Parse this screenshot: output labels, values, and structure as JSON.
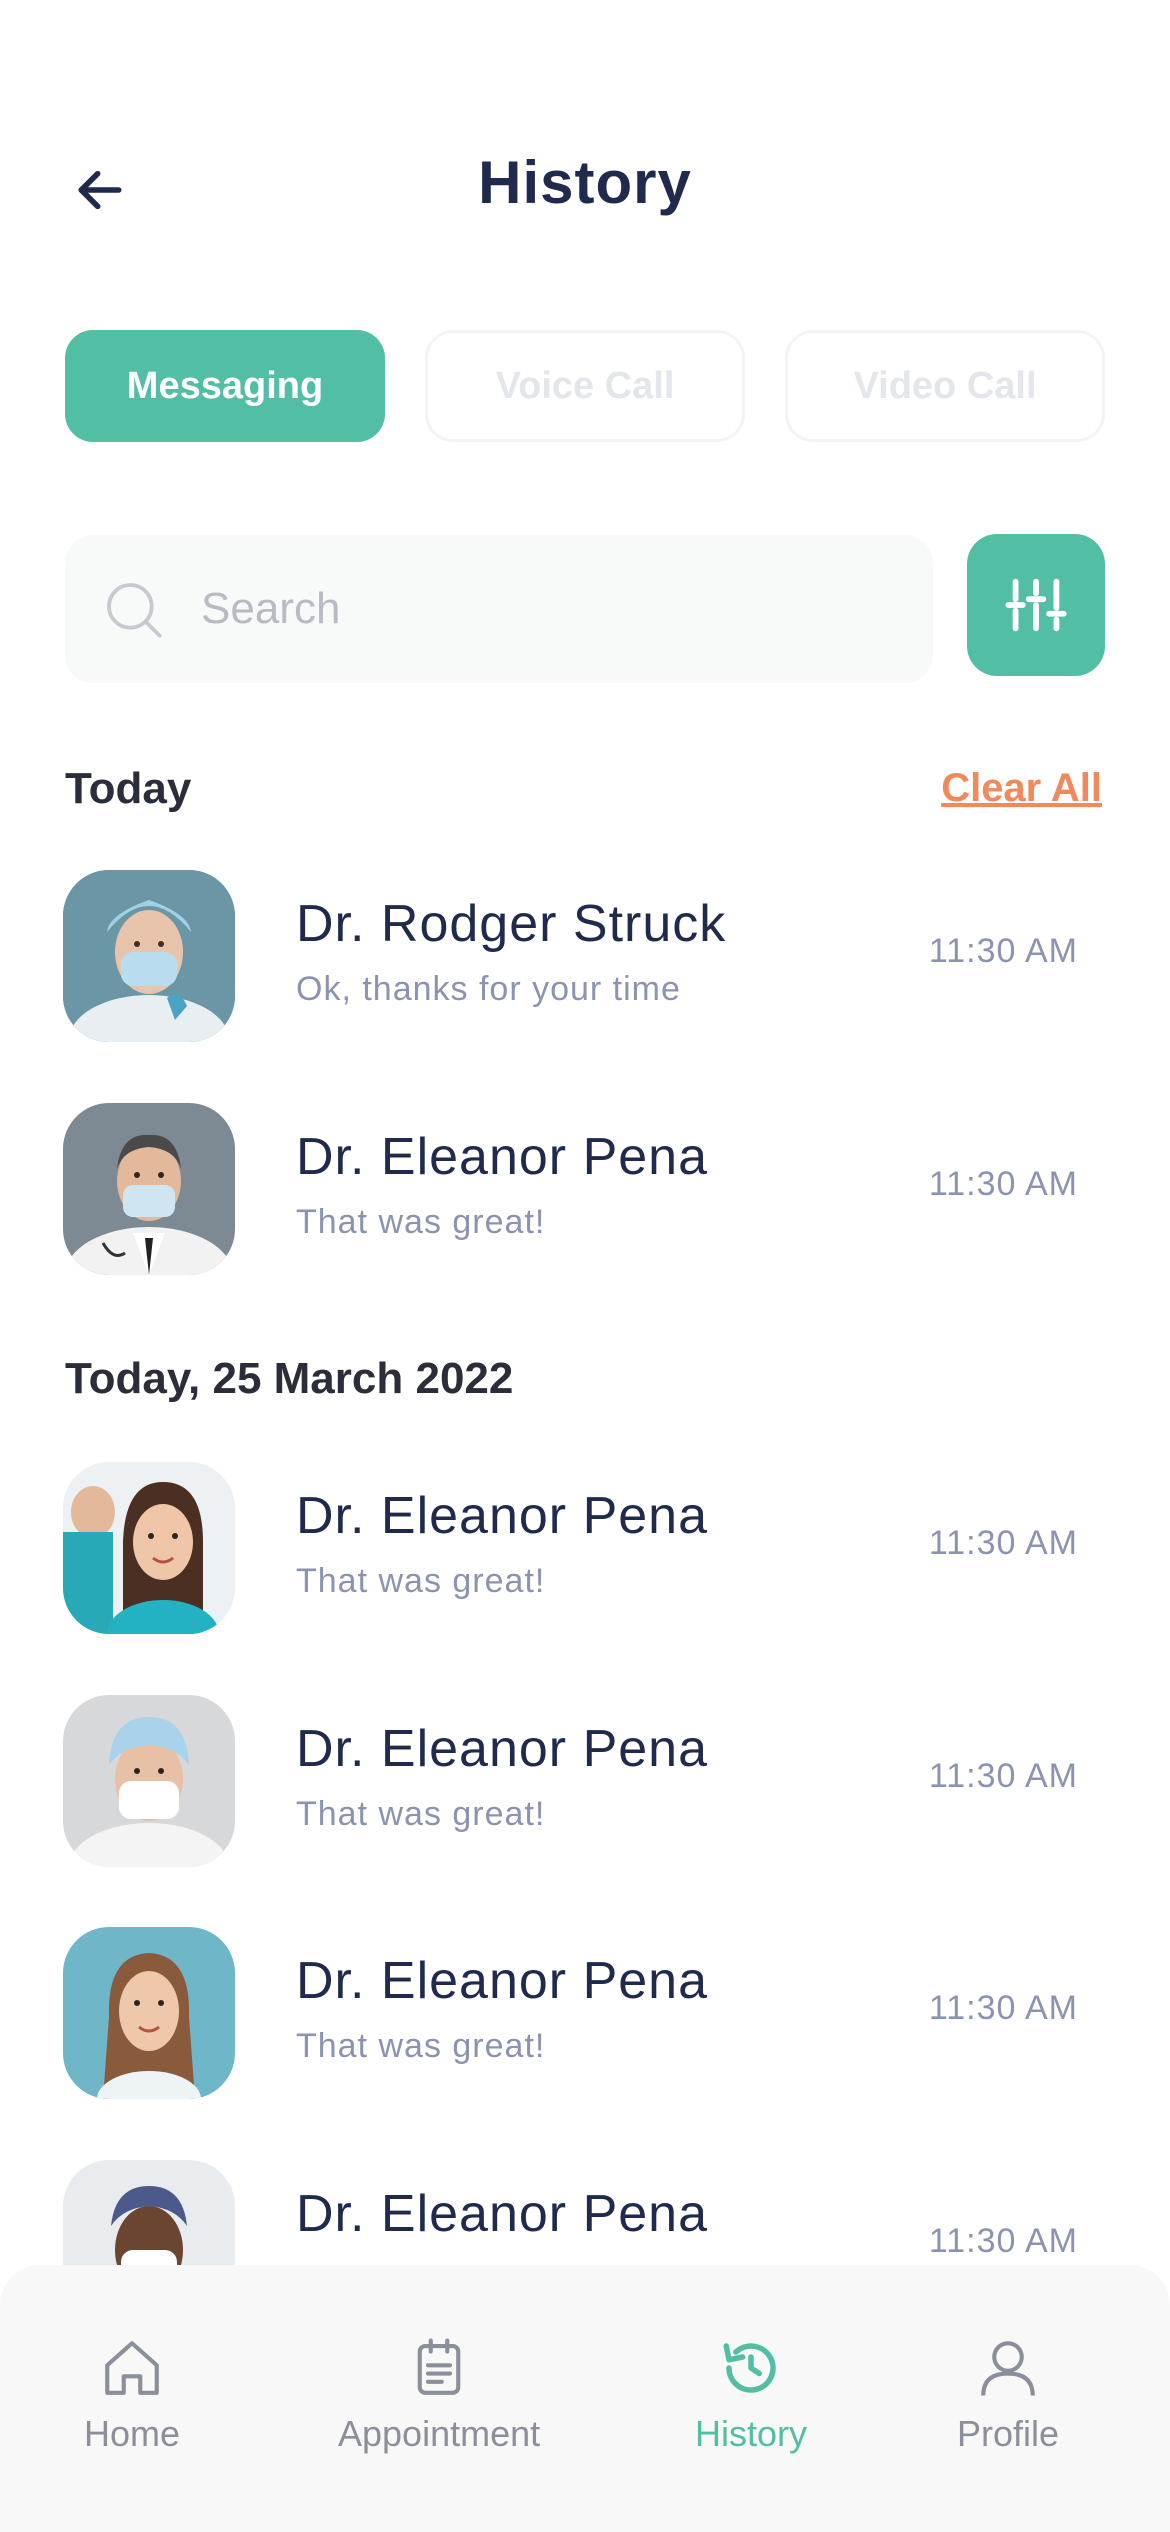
{
  "header": {
    "title": "History",
    "back_icon": "arrow-left-icon"
  },
  "tabs": [
    {
      "label": "Messaging",
      "active": true
    },
    {
      "label": "Voice Call",
      "active": false
    },
    {
      "label": "Video Call",
      "active": false
    }
  ],
  "search": {
    "placeholder": "Search",
    "value": "",
    "icon": "search-icon"
  },
  "filter": {
    "icon": "sliders-icon"
  },
  "sections": [
    {
      "title": "Today",
      "action_label": "Clear All",
      "items": [
        {
          "name": "Dr. Rodger Struck",
          "message": "Ok, thanks for your time",
          "time": "11:30 AM"
        },
        {
          "name": "Dr. Eleanor Pena",
          "message": "That was great!",
          "time": "11:30 AM"
        }
      ]
    },
    {
      "title": "Today, 25 March 2022",
      "items": [
        {
          "name": "Dr. Eleanor Pena",
          "message": "That was great!",
          "time": "11:30 AM"
        },
        {
          "name": "Dr. Eleanor Pena",
          "message": "That was great!",
          "time": "11:30 AM"
        },
        {
          "name": "Dr. Eleanor Pena",
          "message": "That was great!",
          "time": "11:30 AM"
        },
        {
          "name": "Dr. Eleanor Pena",
          "message": "",
          "time": "11:30 AM"
        }
      ]
    }
  ],
  "nav": [
    {
      "label": "Home",
      "icon": "home-icon",
      "active": false
    },
    {
      "label": "Appointment",
      "icon": "clipboard-icon",
      "active": false
    },
    {
      "label": "History",
      "icon": "history-icon",
      "active": true
    },
    {
      "label": "Profile",
      "icon": "user-icon",
      "active": false
    }
  ],
  "colors": {
    "accent": "#52bfa5",
    "clear_all": "#f08a5d",
    "title": "#1f2a4d",
    "muted": "#8b93b0"
  }
}
